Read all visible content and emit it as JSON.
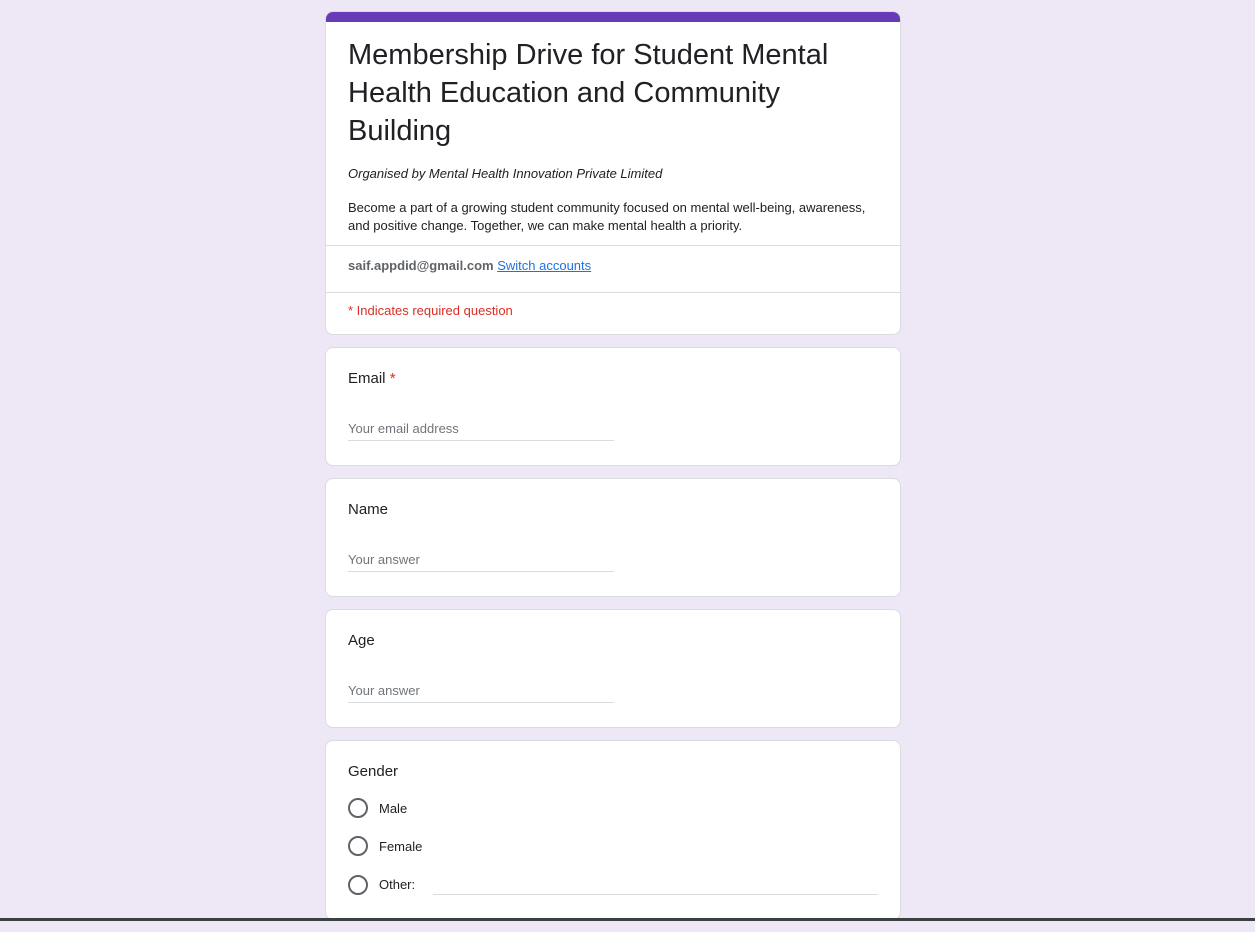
{
  "form": {
    "accent_color": "#673ab7",
    "background_color": "#ede7f6",
    "title": "Membership Drive for Student Mental Health Education and Community Building",
    "organiser": "Organised by Mental Health Innovation Private Limited",
    "description": "Become a part of a growing student community focused on mental well-being, awareness, and positive change. Together, we can make mental health a priority.",
    "account_email": "saif.appdid@gmail.com",
    "switch_accounts": "Switch accounts",
    "required_note": "* Indicates required question"
  },
  "questions": {
    "email": {
      "label": "Email",
      "required_mark": "*",
      "placeholder": "Your email address"
    },
    "name": {
      "label": "Name",
      "placeholder": "Your answer"
    },
    "age": {
      "label": "Age",
      "placeholder": "Your answer"
    },
    "gender": {
      "label": "Gender",
      "options": [
        "Male",
        "Female",
        "Other:"
      ]
    }
  }
}
